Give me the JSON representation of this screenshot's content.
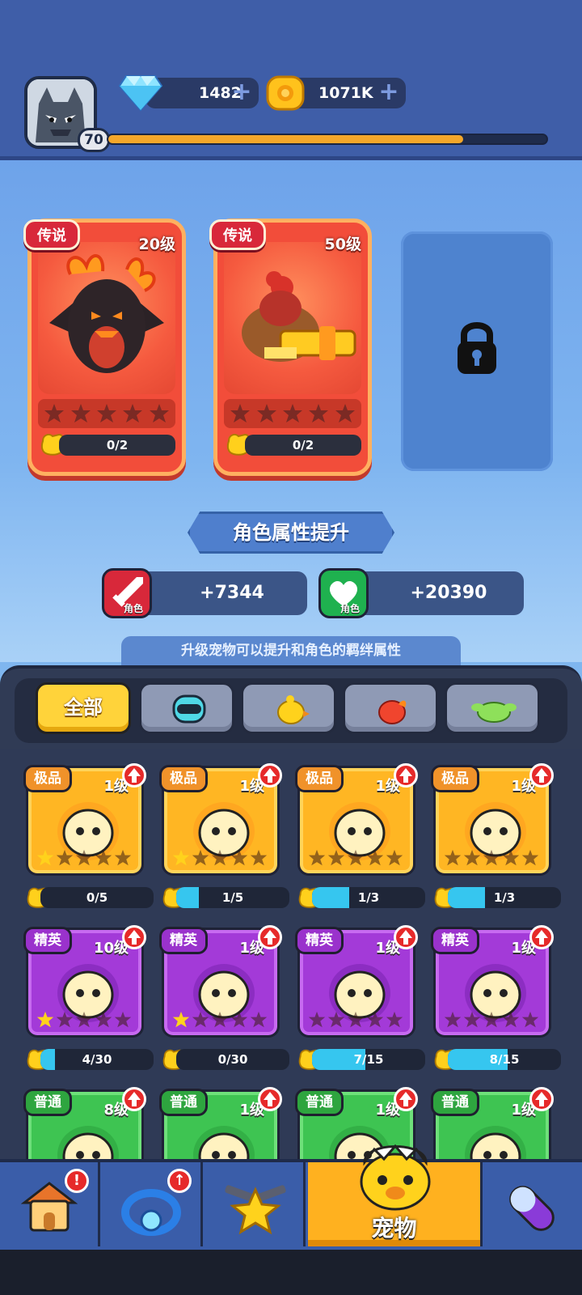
{
  "header": {
    "player_level": "70",
    "xp_fraction": 0.81,
    "gems": "1482",
    "gold": "1071K"
  },
  "equipped_pets": [
    {
      "rarity": "传说",
      "level": "20级",
      "progress": "0/2",
      "stars_filled": 0,
      "icon": "dragon-icon"
    },
    {
      "rarity": "传说",
      "level": "50级",
      "progress": "0/2",
      "stars_filled": 0,
      "icon": "chicken-gun-icon"
    }
  ],
  "locked_slot_icon": "lock-icon",
  "bonus": {
    "title": "角色属性提升",
    "attack_tag": "角色",
    "attack_value": "+7344",
    "hp_tag": "角色",
    "hp_value": "+20390",
    "hint": "升级宠物可以提升和角色的羁绊属性"
  },
  "filters": {
    "all_label": "全部",
    "icons": [
      "robot-filter-icon",
      "chick-filter-icon",
      "fire-filter-icon",
      "slime-filter-icon"
    ]
  },
  "pets": [
    {
      "rarity": "极品",
      "level": "1级",
      "progress": "0/5",
      "fill": 0.0,
      "stars_filled": 1,
      "tier": "gold",
      "icon": "robot-pet-icon"
    },
    {
      "rarity": "极品",
      "level": "1级",
      "progress": "1/5",
      "fill": 0.2,
      "stars_filled": 1,
      "tier": "gold",
      "icon": "knight-pet-icon"
    },
    {
      "rarity": "极品",
      "level": "1级",
      "progress": "1/3",
      "fill": 0.33,
      "stars_filled": 0,
      "tier": "gold",
      "icon": "red-monster-pet-icon"
    },
    {
      "rarity": "极品",
      "level": "1级",
      "progress": "1/3",
      "fill": 0.33,
      "stars_filled": 0,
      "tier": "gold",
      "icon": "flame-spirit-pet-icon"
    },
    {
      "rarity": "精英",
      "level": "10级",
      "progress": "4/30",
      "fill": 0.13,
      "stars_filled": 1,
      "tier": "purple",
      "icon": "chick-pet-icon"
    },
    {
      "rarity": "精英",
      "level": "1级",
      "progress": "0/30",
      "fill": 0.0,
      "stars_filled": 1,
      "tier": "purple",
      "icon": "heli-robot-pet-icon"
    },
    {
      "rarity": "精英",
      "level": "1级",
      "progress": "7/15",
      "fill": 0.47,
      "stars_filled": 0,
      "tier": "purple",
      "icon": "red-blob-pet-icon"
    },
    {
      "rarity": "精英",
      "level": "1级",
      "progress": "8/15",
      "fill": 0.53,
      "stars_filled": 0,
      "tier": "purple",
      "icon": "sprout-pet-icon"
    },
    {
      "rarity": "普通",
      "level": "8级",
      "tier": "green",
      "icon": "egg-pet-icon"
    },
    {
      "rarity": "普通",
      "level": "1级",
      "tier": "green",
      "icon": "helmet-pet-icon"
    },
    {
      "rarity": "普通",
      "level": "1级",
      "tier": "green",
      "icon": "fire-pet-icon"
    },
    {
      "rarity": "普通",
      "level": "1级",
      "tier": "green",
      "icon": "ghost-pet-icon"
    }
  ],
  "nav": {
    "items": [
      {
        "name": "shop",
        "icon": "house-icon",
        "badge": "!"
      },
      {
        "name": "gear",
        "icon": "ring-icon",
        "badge": "up"
      },
      {
        "name": "battle",
        "icon": "crossed-guns-star-icon"
      },
      {
        "name": "pets",
        "icon": "pet-egg-chick-icon",
        "label": "宠物"
      },
      {
        "name": "items",
        "icon": "capsule-icon"
      }
    ]
  },
  "colors": {
    "legend_red": "#f24d3a",
    "gold_tier": "#ffb623",
    "purple_tier": "#a33ad8",
    "green_tier": "#3ec452",
    "active_tab": "#ffd33a"
  }
}
